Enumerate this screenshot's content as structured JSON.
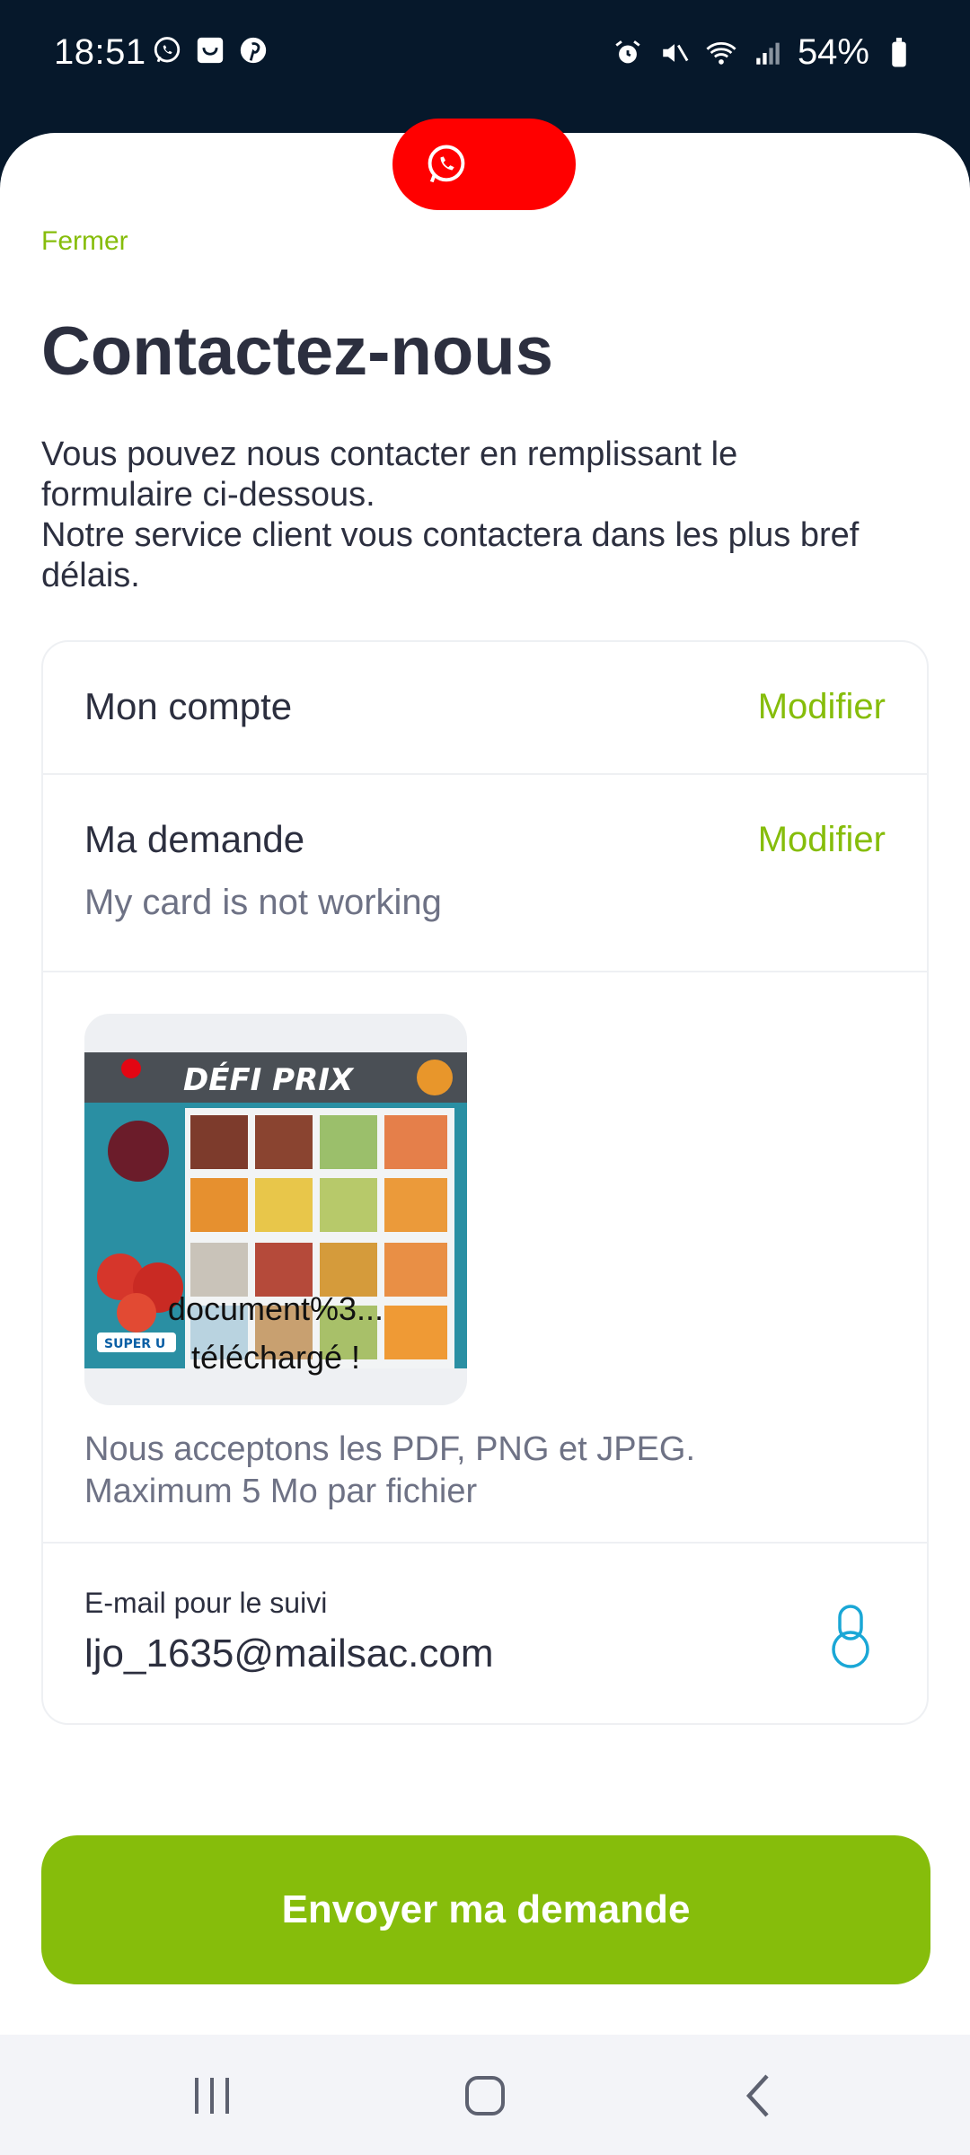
{
  "status_bar": {
    "time": "18:51",
    "battery": "54%",
    "notification_icons": [
      "whatsapp-icon",
      "bag-icon",
      "pinterest-icon"
    ],
    "system_icons": [
      "alarm-icon",
      "mute-icon",
      "wifi-icon",
      "signal-icon",
      "battery-icon"
    ]
  },
  "floating_button": {
    "icon": "whatsapp-icon",
    "color": "#ff0000"
  },
  "header": {
    "close_label": "Fermer",
    "title": "Contactez-nous",
    "intro_lines": [
      "Vous pouvez nous contacter en remplissant le",
      "formulaire ci-dessous.",
      "Notre service client vous contactera dans les plus bref",
      "délais."
    ]
  },
  "form": {
    "account": {
      "label": "Mon compte",
      "action": "Modifier"
    },
    "request": {
      "label": "Ma demande",
      "action": "Modifier",
      "value": "My card is not working"
    },
    "attachment": {
      "flyer_title": "DÉFI PRIX",
      "flyer_badge": "SUPER U",
      "caption_line1": "document%3...",
      "caption_line2": "téléchargé !",
      "hint_line1": "Nous acceptons les PDF, PNG et JPEG.",
      "hint_line2": "Maximum 5 Mo par fichier"
    },
    "email": {
      "label": "E-mail pour le suivi",
      "value": "ljo_1635@mailsac.com",
      "icon": "lock-icon"
    }
  },
  "submit_label": "Envoyer ma demande",
  "colors": {
    "accent": "#86bd0b",
    "title": "#2c2f3f",
    "muted": "#6e7285",
    "status_bar": "#06182b"
  },
  "nav_bar": {
    "buttons": [
      "recents-icon",
      "home-icon",
      "back-icon"
    ]
  }
}
